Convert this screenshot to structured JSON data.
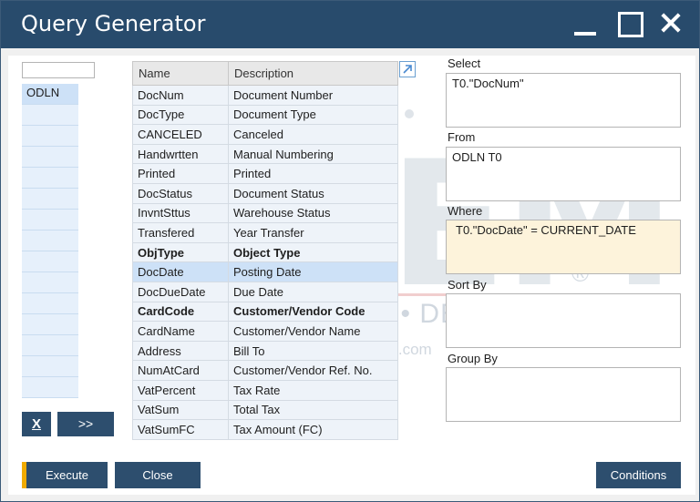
{
  "window": {
    "title": "Query Generator"
  },
  "tables": {
    "filter_value": "",
    "items": [
      "ODLN",
      "",
      "",
      "",
      "",
      "",
      "",
      "",
      "",
      "",
      "",
      "",
      "",
      "",
      "",
      ""
    ]
  },
  "buttons": {
    "clear": "X",
    "move": ">>",
    "execute": "Execute",
    "close": "Close",
    "conditions": "Conditions"
  },
  "grid": {
    "headers": [
      "Name",
      "Description"
    ],
    "rows": [
      [
        "DocNum",
        "Document Number"
      ],
      [
        "DocType",
        "Document Type"
      ],
      [
        "CANCELED",
        "Canceled"
      ],
      [
        "Handwrtten",
        "Manual Numbering"
      ],
      [
        "Printed",
        "Printed"
      ],
      [
        "DocStatus",
        "Document Status"
      ],
      [
        "InvntSttus",
        "Warehouse Status"
      ],
      [
        "Transfered",
        "Year Transfer"
      ],
      [
        "ObjType",
        "Object Type"
      ],
      [
        "DocDate",
        "Posting Date"
      ],
      [
        "DocDueDate",
        "Due Date"
      ],
      [
        "CardCode",
        "Customer/Vendor Code"
      ],
      [
        "CardName",
        "Customer/Vendor Name"
      ],
      [
        "Address",
        "Bill To"
      ],
      [
        "NumAtCard",
        "Customer/Vendor Ref. No."
      ],
      [
        "VatPercent",
        "Tax Rate"
      ],
      [
        "VatSum",
        "Total Tax"
      ],
      [
        "VatSumFC",
        "Tax Amount (FC)"
      ]
    ]
  },
  "clauses": {
    "select": {
      "label": "Select",
      "value": "T0.\"DocNum\""
    },
    "from": {
      "label": "From",
      "value": "ODLN T0"
    },
    "where": {
      "label": "Where",
      "value": "T0.\"DocDate\" = CURRENT_DATE"
    },
    "sort_by": {
      "label": "Sort By",
      "value": ""
    },
    "group_by": {
      "label": "Group By",
      "value": ""
    }
  },
  "watermark": {
    "big": "STEM",
    "sub": "INNOVATION • DESIGN • VALUE",
    "url": "www.sterling-team.com",
    "reg": "®"
  },
  "colors": {
    "titlebar": "#284b6c",
    "button": "#2d4e6e",
    "accent": "#f0ab00",
    "selected": "#cde1f7"
  }
}
